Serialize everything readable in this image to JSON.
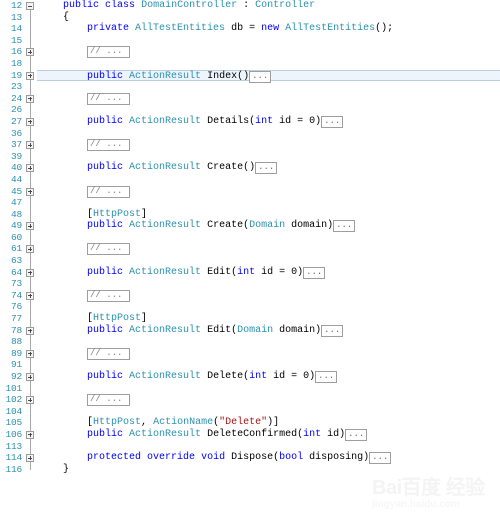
{
  "editor": {
    "language": "C#",
    "file_kind": "controller-source",
    "colors": {
      "keyword": "#0000ff",
      "type": "#2b91af",
      "string": "#a31515",
      "plain": "#000000",
      "line_number": "#2b91af",
      "selection_background": "#eef4fb",
      "selection_border": "#b9cfe4",
      "background": "#ffffff"
    },
    "collapsed_marker": "...",
    "lines": [
      {
        "num": "12",
        "outline": "minus",
        "guide": "half-top",
        "indent": 2,
        "tokens": [
          {
            "t": "public",
            "c": "kw"
          },
          {
            "t": " ",
            "c": "pln"
          },
          {
            "t": "class",
            "c": "kw"
          },
          {
            "t": " ",
            "c": "pln"
          },
          {
            "t": "DomainController",
            "c": "typ"
          },
          {
            "t": " : ",
            "c": "pln"
          },
          {
            "t": "Controller",
            "c": "typ"
          }
        ]
      },
      {
        "num": "13",
        "outline": "none",
        "guide": "full",
        "indent": 2,
        "tokens": [
          {
            "t": "{",
            "c": "pln"
          }
        ]
      },
      {
        "num": "14",
        "outline": "none",
        "guide": "full",
        "indent": 4,
        "tokens": [
          {
            "t": "private",
            "c": "kw"
          },
          {
            "t": " ",
            "c": "pln"
          },
          {
            "t": "AllTestEntities",
            "c": "typ"
          },
          {
            "t": " db = ",
            "c": "pln"
          },
          {
            "t": "new",
            "c": "kw"
          },
          {
            "t": " ",
            "c": "pln"
          },
          {
            "t": "AllTestEntities",
            "c": "typ"
          },
          {
            "t": "();",
            "c": "pln"
          }
        ]
      },
      {
        "num": "15",
        "outline": "none",
        "guide": "full",
        "indent": 4,
        "tokens": []
      },
      {
        "num": "16",
        "outline": "plus",
        "guide": "full",
        "indent": 4,
        "tokens": [],
        "collapsed": "comment"
      },
      {
        "num": "18",
        "outline": "none",
        "guide": "full",
        "indent": 4,
        "tokens": []
      },
      {
        "num": "19",
        "outline": "plus",
        "guide": "full",
        "indent": 4,
        "selected": true,
        "tokens": [
          {
            "t": "public",
            "c": "kw"
          },
          {
            "t": " ",
            "c": "pln"
          },
          {
            "t": "ActionResult",
            "c": "typ"
          },
          {
            "t": " Index()",
            "c": "pln"
          }
        ],
        "collapsed": "body"
      },
      {
        "num": "23",
        "outline": "none",
        "guide": "full",
        "indent": 4,
        "tokens": []
      },
      {
        "num": "24",
        "outline": "plus",
        "guide": "full",
        "indent": 4,
        "tokens": [],
        "collapsed": "comment"
      },
      {
        "num": "26",
        "outline": "none",
        "guide": "full",
        "indent": 4,
        "tokens": []
      },
      {
        "num": "27",
        "outline": "plus",
        "guide": "full",
        "indent": 4,
        "tokens": [
          {
            "t": "public",
            "c": "kw"
          },
          {
            "t": " ",
            "c": "pln"
          },
          {
            "t": "ActionResult",
            "c": "typ"
          },
          {
            "t": " Details(",
            "c": "pln"
          },
          {
            "t": "int",
            "c": "kw"
          },
          {
            "t": " id = 0)",
            "c": "pln"
          }
        ],
        "collapsed": "body"
      },
      {
        "num": "36",
        "outline": "none",
        "guide": "full",
        "indent": 4,
        "tokens": []
      },
      {
        "num": "37",
        "outline": "plus",
        "guide": "full",
        "indent": 4,
        "tokens": [],
        "collapsed": "comment"
      },
      {
        "num": "39",
        "outline": "none",
        "guide": "full",
        "indent": 4,
        "tokens": []
      },
      {
        "num": "40",
        "outline": "plus",
        "guide": "full",
        "indent": 4,
        "tokens": [
          {
            "t": "public",
            "c": "kw"
          },
          {
            "t": " ",
            "c": "pln"
          },
          {
            "t": "ActionResult",
            "c": "typ"
          },
          {
            "t": " Create()",
            "c": "pln"
          }
        ],
        "collapsed": "body"
      },
      {
        "num": "44",
        "outline": "none",
        "guide": "full",
        "indent": 4,
        "tokens": []
      },
      {
        "num": "45",
        "outline": "plus",
        "guide": "full",
        "indent": 4,
        "tokens": [],
        "collapsed": "comment"
      },
      {
        "num": "47",
        "outline": "none",
        "guide": "full",
        "indent": 4,
        "tokens": []
      },
      {
        "num": "48",
        "outline": "none",
        "guide": "full",
        "indent": 4,
        "tokens": [
          {
            "t": "[",
            "c": "pln"
          },
          {
            "t": "HttpPost",
            "c": "attr"
          },
          {
            "t": "]",
            "c": "pln"
          }
        ]
      },
      {
        "num": "49",
        "outline": "plus",
        "guide": "full",
        "indent": 4,
        "tokens": [
          {
            "t": "public",
            "c": "kw"
          },
          {
            "t": " ",
            "c": "pln"
          },
          {
            "t": "ActionResult",
            "c": "typ"
          },
          {
            "t": " Create(",
            "c": "pln"
          },
          {
            "t": "Domain",
            "c": "typ"
          },
          {
            "t": " domain)",
            "c": "pln"
          }
        ],
        "collapsed": "body"
      },
      {
        "num": "60",
        "outline": "none",
        "guide": "full",
        "indent": 4,
        "tokens": []
      },
      {
        "num": "61",
        "outline": "plus",
        "guide": "full",
        "indent": 4,
        "tokens": [],
        "collapsed": "comment"
      },
      {
        "num": "63",
        "outline": "none",
        "guide": "full",
        "indent": 4,
        "tokens": []
      },
      {
        "num": "64",
        "outline": "plus",
        "guide": "full",
        "indent": 4,
        "tokens": [
          {
            "t": "public",
            "c": "kw"
          },
          {
            "t": " ",
            "c": "pln"
          },
          {
            "t": "ActionResult",
            "c": "typ"
          },
          {
            "t": " Edit(",
            "c": "pln"
          },
          {
            "t": "int",
            "c": "kw"
          },
          {
            "t": " id = 0)",
            "c": "pln"
          }
        ],
        "collapsed": "body"
      },
      {
        "num": "73",
        "outline": "none",
        "guide": "full",
        "indent": 4,
        "tokens": []
      },
      {
        "num": "74",
        "outline": "plus",
        "guide": "full",
        "indent": 4,
        "tokens": [],
        "collapsed": "comment"
      },
      {
        "num": "76",
        "outline": "none",
        "guide": "full",
        "indent": 4,
        "tokens": []
      },
      {
        "num": "77",
        "outline": "none",
        "guide": "full",
        "indent": 4,
        "tokens": [
          {
            "t": "[",
            "c": "pln"
          },
          {
            "t": "HttpPost",
            "c": "attr"
          },
          {
            "t": "]",
            "c": "pln"
          }
        ]
      },
      {
        "num": "78",
        "outline": "plus",
        "guide": "full",
        "indent": 4,
        "tokens": [
          {
            "t": "public",
            "c": "kw"
          },
          {
            "t": " ",
            "c": "pln"
          },
          {
            "t": "ActionResult",
            "c": "typ"
          },
          {
            "t": " Edit(",
            "c": "pln"
          },
          {
            "t": "Domain",
            "c": "typ"
          },
          {
            "t": " domain)",
            "c": "pln"
          }
        ],
        "collapsed": "body"
      },
      {
        "num": "88",
        "outline": "none",
        "guide": "full",
        "indent": 4,
        "tokens": []
      },
      {
        "num": "89",
        "outline": "plus",
        "guide": "full",
        "indent": 4,
        "tokens": [],
        "collapsed": "comment"
      },
      {
        "num": "91",
        "outline": "none",
        "guide": "full",
        "indent": 4,
        "tokens": []
      },
      {
        "num": "92",
        "outline": "plus",
        "guide": "full",
        "indent": 4,
        "tokens": [
          {
            "t": "public",
            "c": "kw"
          },
          {
            "t": " ",
            "c": "pln"
          },
          {
            "t": "ActionResult",
            "c": "typ"
          },
          {
            "t": " Delete(",
            "c": "pln"
          },
          {
            "t": "int",
            "c": "kw"
          },
          {
            "t": " id = 0)",
            "c": "pln"
          }
        ],
        "collapsed": "body"
      },
      {
        "num": "101",
        "outline": "none",
        "guide": "full",
        "indent": 4,
        "tokens": []
      },
      {
        "num": "102",
        "outline": "plus",
        "guide": "full",
        "indent": 4,
        "tokens": [],
        "collapsed": "comment"
      },
      {
        "num": "104",
        "outline": "none",
        "guide": "full",
        "indent": 4,
        "tokens": []
      },
      {
        "num": "105",
        "outline": "none",
        "guide": "full",
        "indent": 4,
        "tokens": [
          {
            "t": "[",
            "c": "pln"
          },
          {
            "t": "HttpPost",
            "c": "attr"
          },
          {
            "t": ", ",
            "c": "pln"
          },
          {
            "t": "ActionName",
            "c": "attr"
          },
          {
            "t": "(",
            "c": "pln"
          },
          {
            "t": "\"Delete\"",
            "c": "str"
          },
          {
            "t": ")]",
            "c": "pln"
          }
        ]
      },
      {
        "num": "106",
        "outline": "plus",
        "guide": "full",
        "indent": 4,
        "tokens": [
          {
            "t": "public",
            "c": "kw"
          },
          {
            "t": " ",
            "c": "pln"
          },
          {
            "t": "ActionResult",
            "c": "typ"
          },
          {
            "t": " DeleteConfirmed(",
            "c": "pln"
          },
          {
            "t": "int",
            "c": "kw"
          },
          {
            "t": " id)",
            "c": "pln"
          }
        ],
        "collapsed": "body"
      },
      {
        "num": "113",
        "outline": "none",
        "guide": "full",
        "indent": 4,
        "tokens": []
      },
      {
        "num": "114",
        "outline": "plus",
        "guide": "full",
        "indent": 4,
        "tokens": [
          {
            "t": "protected",
            "c": "kw"
          },
          {
            "t": " ",
            "c": "pln"
          },
          {
            "t": "override",
            "c": "kw"
          },
          {
            "t": " ",
            "c": "pln"
          },
          {
            "t": "void",
            "c": "kw"
          },
          {
            "t": " Dispose(",
            "c": "pln"
          },
          {
            "t": "bool",
            "c": "kw"
          },
          {
            "t": " disposing)",
            "c": "pln"
          }
        ],
        "collapsed": "body"
      },
      {
        "num": "116",
        "outline": "none",
        "guide": "half-bottom",
        "indent": 2,
        "tokens": [
          {
            "t": "}",
            "c": "pln"
          }
        ]
      }
    ]
  },
  "watermark": {
    "main": "Bai百度 经验",
    "brand": "Bai",
    "brand_cn": "百度经验",
    "sub": "jingyan.baidu.com"
  }
}
